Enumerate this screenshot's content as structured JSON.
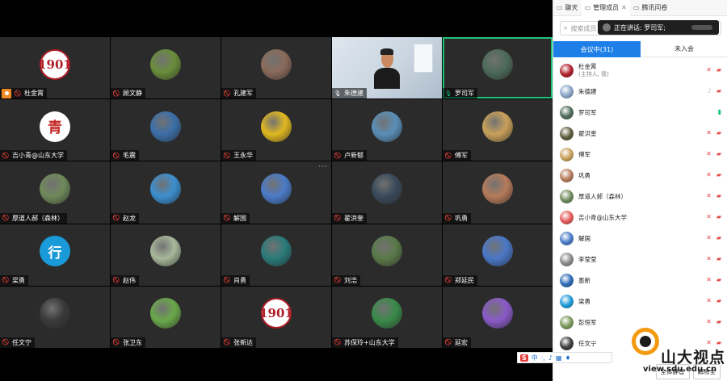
{
  "tabs": [
    {
      "icon": "chat-icon",
      "label": "聊天"
    },
    {
      "icon": "members-icon",
      "label": "管理成员"
    },
    {
      "icon": "survey-icon",
      "label": "腾讯问卷"
    }
  ],
  "search_placeholder": "搜索成员",
  "speaking_toast": "正在讲话: 罗司军;",
  "segments": {
    "in_meeting": "会议中(31)",
    "not_joined": "未入会"
  },
  "grid": [
    {
      "name": "杜金霄",
      "avatar": "sdu-logo",
      "host": true
    },
    {
      "name": "顾文静",
      "avatar": "landscape"
    },
    {
      "name": "孔建军",
      "avatar": "landscape"
    },
    {
      "name": "朱德建",
      "avatar": "video",
      "mic": "on"
    },
    {
      "name": "罗司军",
      "avatar": "landscape",
      "speaking": true,
      "mic": "speaking"
    },
    {
      "name": "吉小青@山东大学",
      "avatar": "seal"
    },
    {
      "name": "毛震",
      "avatar": "landscape"
    },
    {
      "name": "王永华",
      "avatar": "landscape"
    },
    {
      "name": "卢新郁",
      "avatar": "landscape"
    },
    {
      "name": "傅军",
      "avatar": "landscape"
    },
    {
      "name": "厚道人郝（森林）",
      "avatar": "landscape"
    },
    {
      "name": "赵龙",
      "avatar": "landscape"
    },
    {
      "name": "解国",
      "avatar": "landscape",
      "more": "···"
    },
    {
      "name": "翟洪奎",
      "avatar": "landscape"
    },
    {
      "name": "巩勇",
      "avatar": "landscape"
    },
    {
      "name": "梁勇",
      "avatar": "xing"
    },
    {
      "name": "赵伟",
      "avatar": "landscape"
    },
    {
      "name": "肖勇",
      "avatar": "landscape"
    },
    {
      "name": "刘浩",
      "avatar": "landscape"
    },
    {
      "name": "郑延民",
      "avatar": "landscape"
    },
    {
      "name": "任文宁",
      "avatar": "landscape"
    },
    {
      "name": "张卫东",
      "avatar": "landscape"
    },
    {
      "name": "张新达",
      "avatar": "sdu-logo"
    },
    {
      "name": "苏保玲+山东大学",
      "avatar": "landscape"
    },
    {
      "name": "延宏",
      "avatar": "landscape"
    }
  ],
  "tile_colors": [
    "#e6e0d4",
    "#6a8e3a",
    "#8a6a5a",
    "#ffffff",
    "#4d6a5a",
    "#ffffff",
    "#3b6fa8",
    "#e0b820",
    "#5a8fb8",
    "#c9a05a",
    "#6f8a5a",
    "#3b8fd0",
    "#4a7bc8",
    "#3a4a5a",
    "#b57a5a",
    "#1a9ad8",
    "#a8b89a",
    "#2a7a7a",
    "#5a7a4a",
    "#4a78c8",
    "#3a3a3a",
    "#6aa84a",
    "#ffffff",
    "#3a8a4a",
    "#8a5ac8"
  ],
  "sdu_logo_text": "1901",
  "seal_glyph": "青",
  "xing_glyph": "行",
  "members": [
    {
      "name": "杜金霄",
      "sub": "(主持人, 我)",
      "color": "#b01e28",
      "status": "mute"
    },
    {
      "name": "朱德建",
      "color": "#8aa6c8",
      "status": "mic-grey"
    },
    {
      "name": "罗司军",
      "color": "#4d6a5a",
      "status": "mic-on"
    },
    {
      "name": "翟洪奎",
      "color": "#5a5a3a",
      "status": "mute"
    },
    {
      "name": "傅军",
      "color": "#c9a05a",
      "status": "mute"
    },
    {
      "name": "巩勇",
      "color": "#b57a5a",
      "status": "mute"
    },
    {
      "name": "厚道人郝（森林）",
      "color": "#6f8a5a",
      "status": "mute"
    },
    {
      "name": "吉小青@山东大学",
      "color": "#e45a5a",
      "status": "mute"
    },
    {
      "name": "解国",
      "color": "#4a7bc8",
      "status": "mute"
    },
    {
      "name": "李莹莹",
      "color": "#8a8a8a",
      "status": "mute"
    },
    {
      "name": "墨新",
      "color": "#2a6ab8",
      "status": "mute"
    },
    {
      "name": "梁勇",
      "color": "#1a9ad8",
      "status": "mute"
    },
    {
      "name": "彭恒军",
      "color": "#7a9a5a",
      "status": "mute"
    },
    {
      "name": "任文宁",
      "color": "#3a3a3a",
      "status": "mute"
    }
  ],
  "buttons": {
    "mute_all": "全体静音",
    "unmute_all": "解除全"
  },
  "ime": {
    "s": "S",
    "lang": "中"
  },
  "watermark": {
    "cn": "山大视点",
    "url": "view.sdu.edu.cn"
  }
}
